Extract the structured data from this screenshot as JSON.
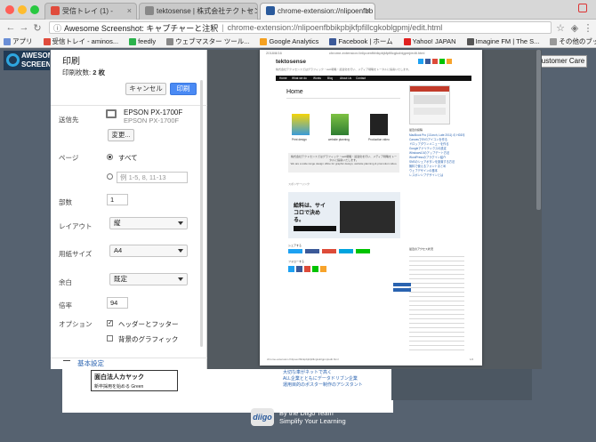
{
  "tabs": [
    {
      "label": "受信トレイ (1) -",
      "icon": "gmail-icon",
      "color": "#e04b3c"
    },
    {
      "label": "tektosense | 株式会社テクトセンス",
      "icon": "tektosense-icon",
      "color": "#888888"
    },
    {
      "label": "chrome-extension://nlipoenfbb",
      "icon": "diigo-tab-icon",
      "color": "#2a5a9c"
    }
  ],
  "address": {
    "host": "Awesome Screenshot: キャプチャーと注釈",
    "url": "chrome-extension://nlipoenfbbikpbjkfpfillcgkoblgpmj/edit.html"
  },
  "bookmarks": [
    "アプリ",
    "受信トレイ - aminos...",
    "feedly",
    "ウェブマスター ツール...",
    "Google Analytics",
    "Facebook | ホーム",
    "Yahoo! JAPAN",
    "Imagine FM | The S...",
    "その他のブックマーク"
  ],
  "app_header": {
    "title": "AWESOME SCREENS"
  },
  "customer_button": "ustomer Care",
  "print": {
    "title": "印刷",
    "sheet_count_label": "印刷枚数:",
    "sheet_count_value": "2 枚",
    "cancel": "キャンセル",
    "print": "印刷",
    "destination_label": "送信先",
    "printer_name": "EPSON PX-1700F",
    "printer_sub": "EPSON PX-1700F",
    "change": "変更...",
    "pages_label": "ページ",
    "pages_all": "すべて",
    "pages_example": "例 1-5, 8, 11-13",
    "copies_label": "部数",
    "copies_value": "1",
    "layout_label": "レイアウト",
    "layout_value": "縦",
    "paper_label": "用紙サイズ",
    "paper_value": "A4",
    "margins_label": "余白",
    "margins_value": "既定",
    "scale_label": "倍率",
    "scale_value": "94",
    "options_label": "オプション",
    "opt_header": "ヘッダーとフッター",
    "opt_bg": "背景のグラフィック",
    "advanced": "基本設定"
  },
  "page_preview": {
    "date": "2018/8/16",
    "url_header": "chrome-extension://nlipoenfbbikpbjkfpfillcgkoblgpmj/edit.html",
    "site_title": "tektosense",
    "tagline": "株式会社テクトセンスではグラフィック・web戦略・最適化を行い、メディア戦略をトータルに提案いたします。",
    "nav": [
      "Home",
      "What we do",
      "Works",
      "Blog",
      "About Us",
      "Contact"
    ],
    "heading": "Home",
    "services": [
      "Print design",
      "website planning",
      "Production video"
    ],
    "jp_text": "株式会社テクトセンスではグラフィック・web戦略・最適化を行い、メディア戦略をトータルに提案いたします。",
    "en_text": "We are a wide range design office for graphic design, website planning & promotion video.",
    "ad_label": "スポンサーリンク",
    "ad_big": "給料は、サイコロで決める。",
    "share_label": "シェアする",
    "follow_label": "フォローする",
    "sidebar_title": "最近の投稿",
    "sidebar_links": [
      "MacBook Pro (13-inch, Late 2011) の HDDをSSDに換装しました",
      "CanvasでSVGアイコンを作る",
      "ドロップダウンメニューを作る",
      "Googleアナリティクスの設定",
      "Windows10のアップデート方法",
      "WordPressのプラグイン紹介",
      "SNSのシェアボタンを設置する方法",
      "無料で使えるフォントまとめ",
      "ウェブデザインの基本",
      "レスポンシブデザインとは"
    ],
    "sidebar_title2": "最近のアクセス状況",
    "footer_url": "chrome-extension://nlipoenfbbikpbjkfpfillcgkoblgpmj/edit.html",
    "footer_page": "1/2",
    "contact_btn": "お問合わせ",
    "service_btn": "サービス"
  },
  "under_page": {
    "ad_text": "面白法人カヤック",
    "ad_sub": "新卒採用を始める Green",
    "link1": "大切な車がネットで高く",
    "link2": "ALL企業とともにデータドリブン企業",
    "link3": "運用目的のポスター制作のアシスタント"
  },
  "diigo": {
    "logo": "diigo",
    "line1": "By the Diigo Team",
    "line2": "Simplify Your Learning"
  }
}
